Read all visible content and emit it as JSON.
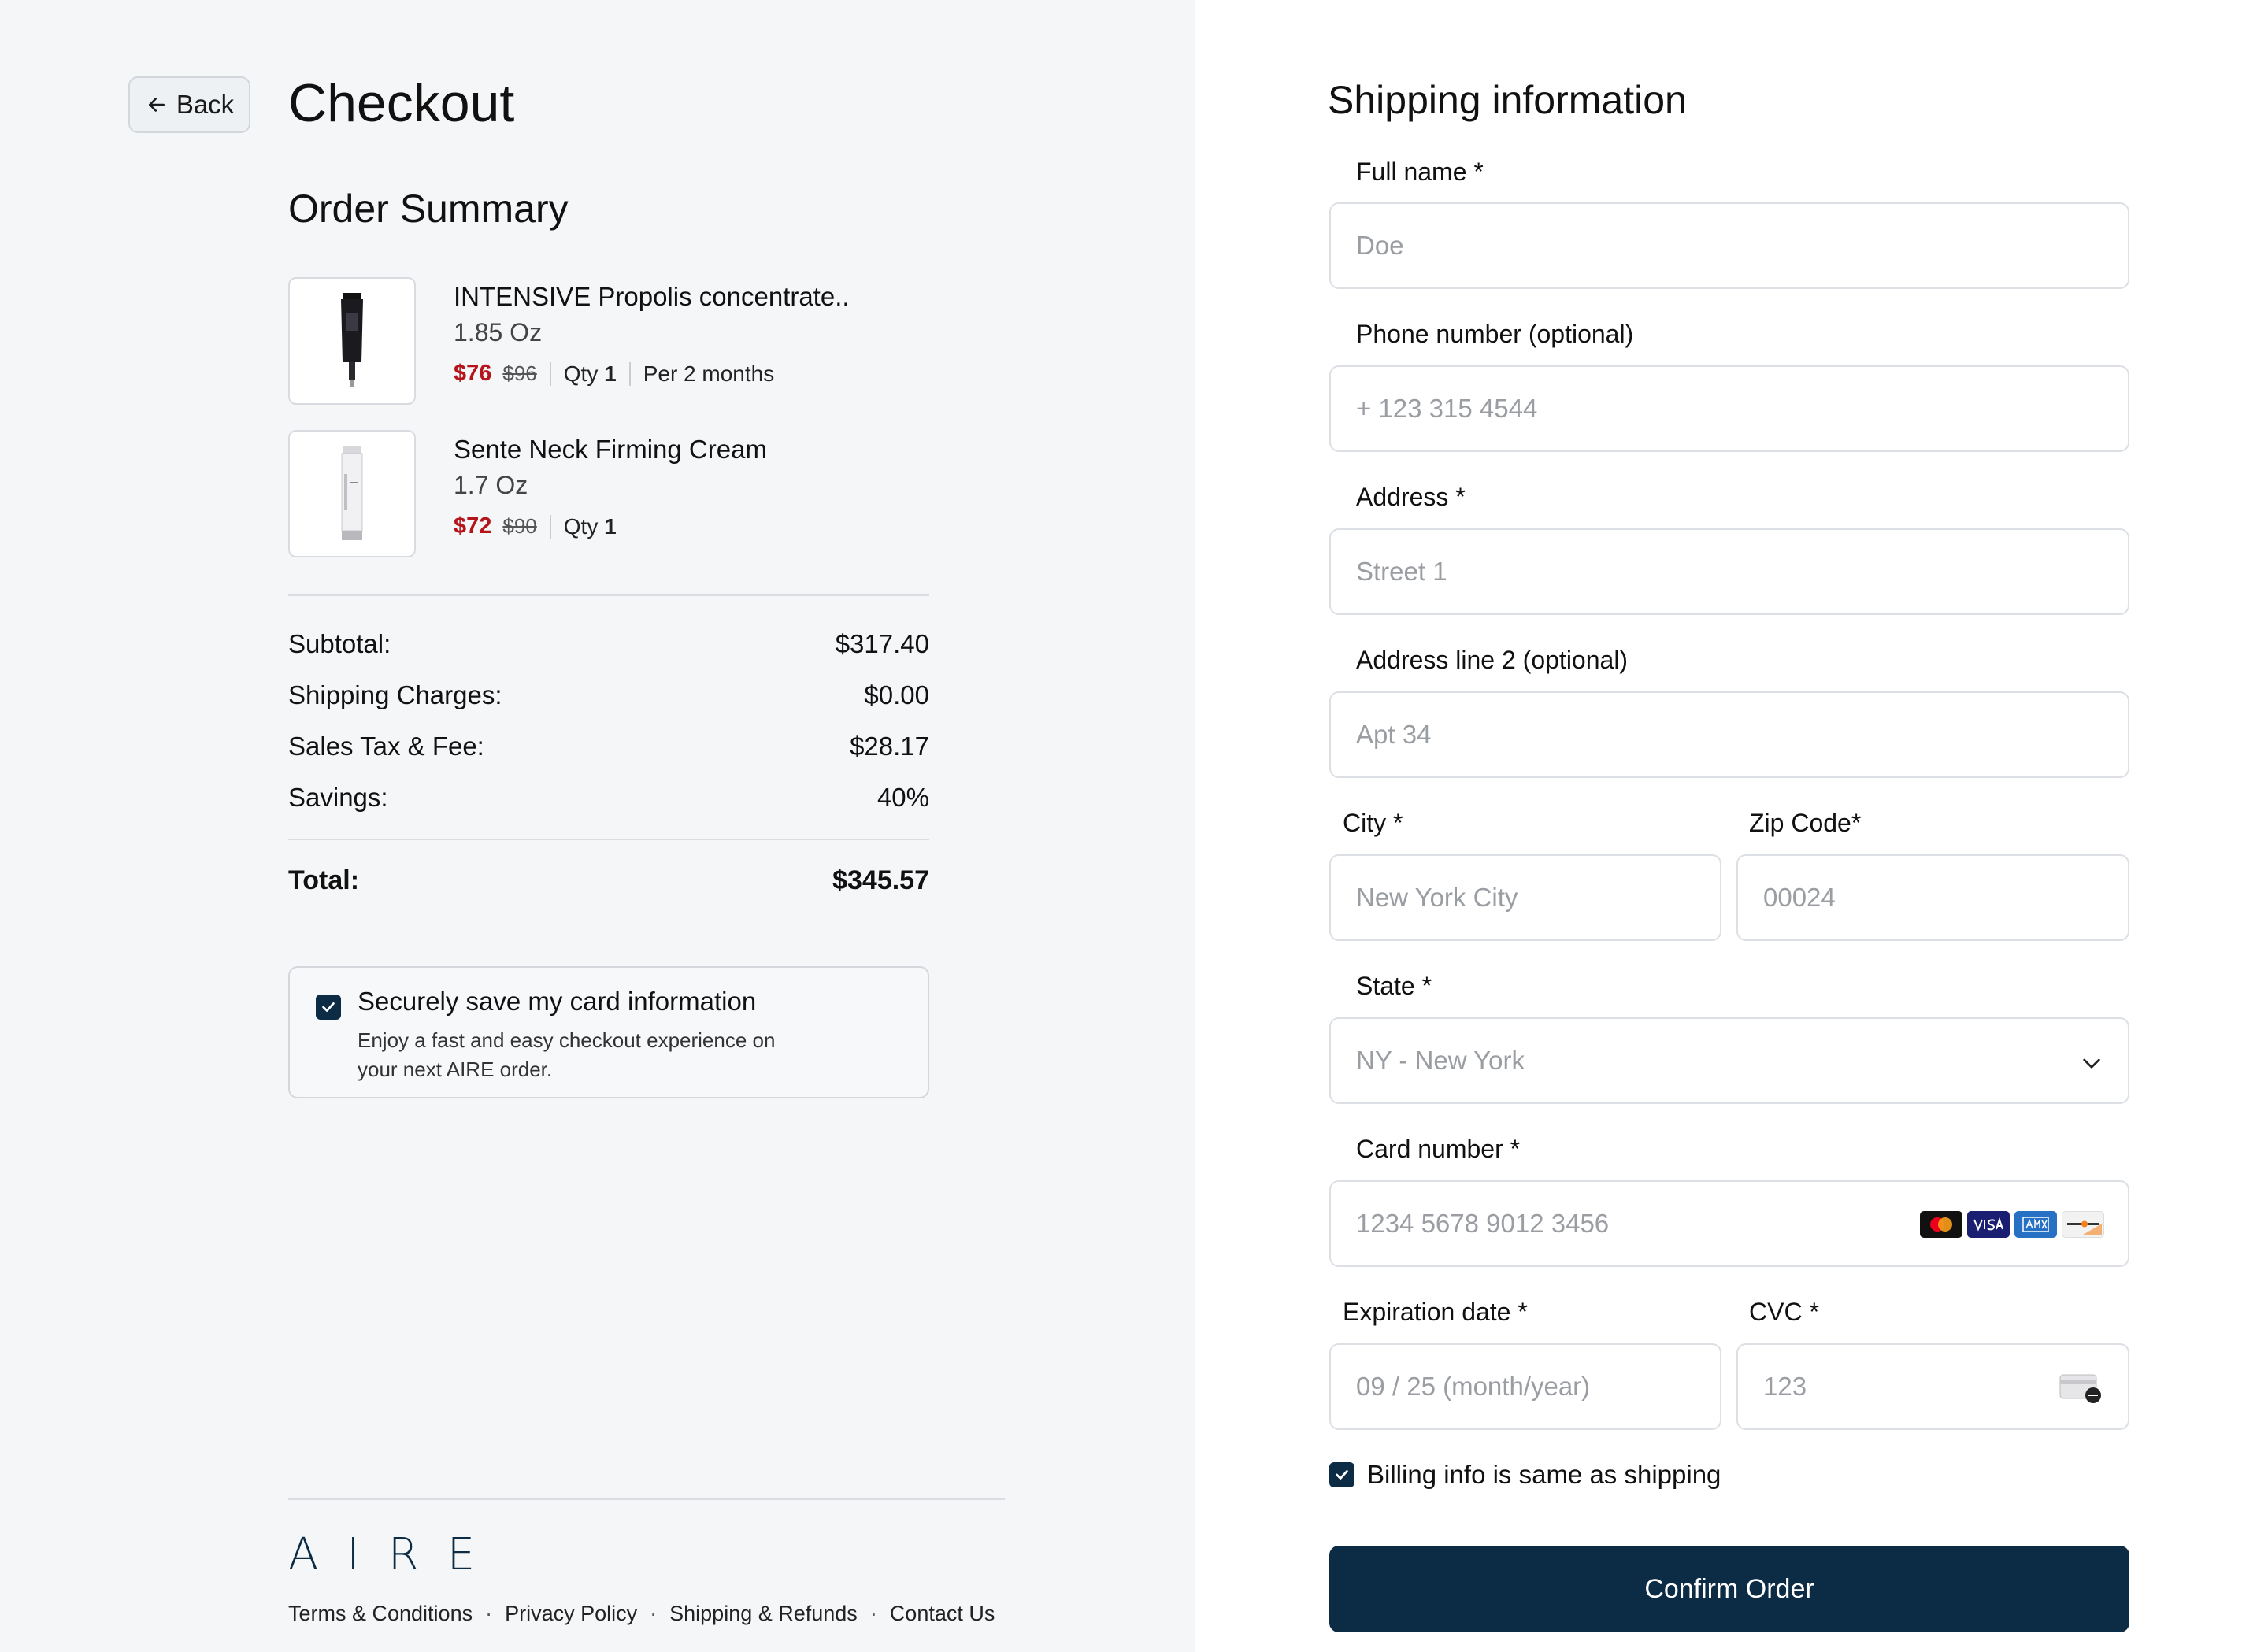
{
  "header": {
    "back_label": "Back",
    "title": "Checkout"
  },
  "order": {
    "title": "Order Summary",
    "items": [
      {
        "name": "INTENSIVE Propolis concentrate..",
        "size": "1.85 Oz",
        "price": "$76",
        "old_price": "$96",
        "qty_label": "Qty",
        "qty": "1",
        "frequency": "Per 2 months"
      },
      {
        "name": "Sente Neck Firming Cream",
        "size": "1.7 Oz",
        "price": "$72",
        "old_price": "$90",
        "qty_label": "Qty",
        "qty": "1"
      }
    ],
    "summary": {
      "subtotal_label": "Subtotal:",
      "subtotal": "$317.40",
      "shipping_label": "Shipping Charges:",
      "shipping": "$0.00",
      "tax_label": "Sales Tax & Fee:",
      "tax": "$28.17",
      "savings_label": "Savings:",
      "savings": "40%",
      "total_label": "Total:",
      "total": "$345.57"
    },
    "save_card": {
      "checked": true,
      "title": "Securely save my card information",
      "description": "Enjoy a fast and easy checkout experience on your next AIRE order."
    }
  },
  "footer": {
    "logo": "AIRE",
    "links": [
      "Terms & Conditions",
      "Privacy Policy",
      "Shipping & Refunds",
      "Contact Us"
    ]
  },
  "shipping": {
    "title": "Shipping information",
    "full_name": {
      "label": "Full name *",
      "placeholder": "Doe"
    },
    "phone": {
      "label": "Phone number (optional)",
      "placeholder": "+ 123 315 4544"
    },
    "address": {
      "label": "Address *",
      "placeholder": "Street 1"
    },
    "address2": {
      "label": "Address line 2 (optional)",
      "placeholder": "Apt 34"
    },
    "city": {
      "label": "City *",
      "placeholder": "New York City"
    },
    "zip": {
      "label": "Zip Code*",
      "placeholder": "00024"
    },
    "state": {
      "label": "State *",
      "value": "NY - New York"
    },
    "card_number": {
      "label": "Card number *",
      "placeholder": "1234 5678 9012 3456"
    },
    "expiration": {
      "label": "Expiration date *",
      "placeholder": "09 / 25 (month/year)"
    },
    "cvc": {
      "label": "CVC *",
      "placeholder": "123"
    },
    "billing_same": {
      "checked": true,
      "label": "Billing info is same as shipping"
    },
    "confirm_label": "Confirm Order"
  },
  "icons": {
    "back": "arrow-left-icon",
    "state": "chevron-down-icon",
    "cards": [
      "mastercard-icon",
      "visa-icon",
      "amex-icon",
      "discover-icon"
    ],
    "cvc": "cvc-card-icon"
  },
  "colors": {
    "brand": "#0c2b45",
    "sale_price": "#b4141a",
    "left_bg": "#f4f6f8"
  }
}
